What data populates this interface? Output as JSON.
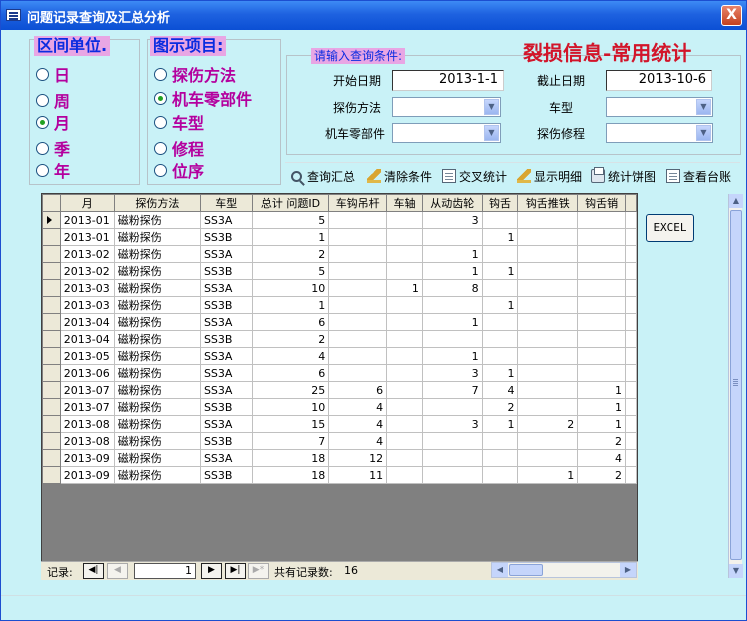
{
  "window": {
    "title": "问题记录查询及汇总分析",
    "close": "X"
  },
  "interval": {
    "title": "区间单位.",
    "options": [
      {
        "label": "日",
        "checked": false
      },
      {
        "label": "周",
        "checked": false
      },
      {
        "label": "月",
        "checked": true
      },
      {
        "label": "季",
        "checked": false
      },
      {
        "label": "年",
        "checked": false
      }
    ]
  },
  "display": {
    "title": "图示项目:",
    "options": [
      {
        "label": "探伤方法",
        "checked": false
      },
      {
        "label": "机车零部件",
        "checked": true
      },
      {
        "label": "车型",
        "checked": false
      },
      {
        "label": "修程",
        "checked": false
      },
      {
        "label": "位序",
        "checked": false
      }
    ]
  },
  "query": {
    "hint": "请输入查询条件:",
    "big_title": "裂损信息-常用统计",
    "start_label": "开始日期",
    "start_value": "2013-1-1",
    "end_label": "截止日期",
    "end_value": "2013-10-6",
    "method_label": "探伤方法",
    "model_label": "车型",
    "part_label": "机车零部件",
    "repair_label": "探伤修程"
  },
  "toolbar": {
    "query_summary": "查询汇总",
    "clear": "清除条件",
    "cross": "交叉统计",
    "detail": "显示明细",
    "pie": "统计饼图",
    "ledger": "查看台账"
  },
  "grid": {
    "columns": [
      "月",
      "探伤方法",
      "车型",
      "总计 问题ID",
      "车钩吊杆",
      "车轴",
      "从动齿轮",
      "钩舌",
      "钩舌推铁",
      "钩舌销",
      ""
    ],
    "rows": [
      [
        "2013-01",
        "磁粉探伤",
        "SS3A",
        "5",
        "",
        "",
        "3",
        "",
        "",
        ""
      ],
      [
        "2013-01",
        "磁粉探伤",
        "SS3B",
        "1",
        "",
        "",
        "",
        "1",
        "",
        ""
      ],
      [
        "2013-02",
        "磁粉探伤",
        "SS3A",
        "2",
        "",
        "",
        "1",
        "",
        "",
        ""
      ],
      [
        "2013-02",
        "磁粉探伤",
        "SS3B",
        "5",
        "",
        "",
        "1",
        "1",
        "",
        ""
      ],
      [
        "2013-03",
        "磁粉探伤",
        "SS3A",
        "10",
        "",
        "1",
        "8",
        "",
        "",
        ""
      ],
      [
        "2013-03",
        "磁粉探伤",
        "SS3B",
        "1",
        "",
        "",
        "",
        "1",
        "",
        ""
      ],
      [
        "2013-04",
        "磁粉探伤",
        "SS3A",
        "6",
        "",
        "",
        "1",
        "",
        "",
        ""
      ],
      [
        "2013-04",
        "磁粉探伤",
        "SS3B",
        "2",
        "",
        "",
        "",
        "",
        "",
        ""
      ],
      [
        "2013-05",
        "磁粉探伤",
        "SS3A",
        "4",
        "",
        "",
        "1",
        "",
        "",
        ""
      ],
      [
        "2013-06",
        "磁粉探伤",
        "SS3A",
        "6",
        "",
        "",
        "3",
        "1",
        "",
        ""
      ],
      [
        "2013-07",
        "磁粉探伤",
        "SS3A",
        "25",
        "6",
        "",
        "7",
        "4",
        "",
        "1"
      ],
      [
        "2013-07",
        "磁粉探伤",
        "SS3B",
        "10",
        "4",
        "",
        "",
        "2",
        "",
        "1"
      ],
      [
        "2013-08",
        "磁粉探伤",
        "SS3A",
        "15",
        "4",
        "",
        "3",
        "1",
        "2",
        "1"
      ],
      [
        "2013-08",
        "磁粉探伤",
        "SS3B",
        "7",
        "4",
        "",
        "",
        "",
        "",
        "2"
      ],
      [
        "2013-09",
        "磁粉探伤",
        "SS3A",
        "18",
        "12",
        "",
        "",
        "",
        "",
        "4"
      ],
      [
        "2013-09",
        "磁粉探伤",
        "SS3B",
        "18",
        "11",
        "",
        "",
        "",
        "1",
        "2"
      ]
    ]
  },
  "nav": {
    "label": "记录:",
    "first": "◀|",
    "prev": "◀",
    "current": "1",
    "next": "▶",
    "last": "▶|",
    "new": "▶*",
    "total_label": "共有记录数:",
    "total": "16"
  },
  "excel_button": "EXCEL"
}
